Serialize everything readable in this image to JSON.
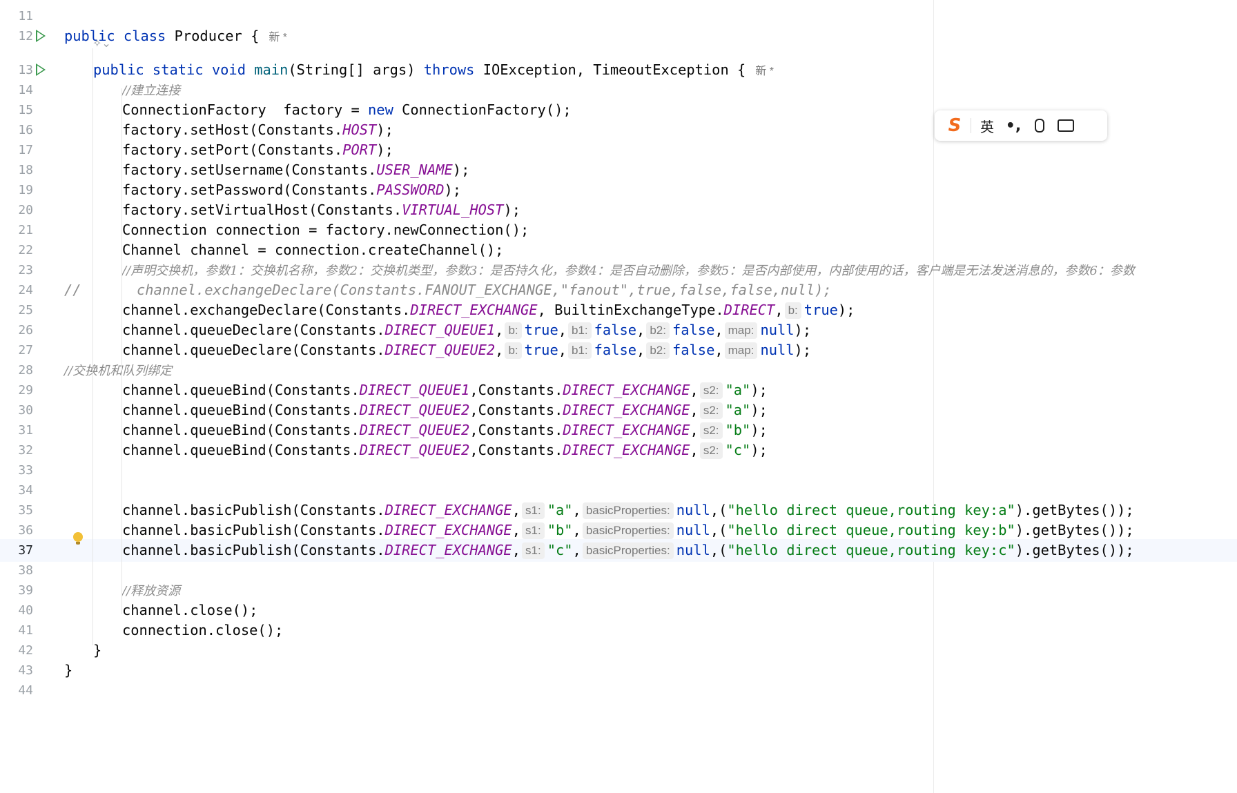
{
  "editor": {
    "new_mark": "新 *",
    "lines": [
      {
        "n": "11"
      },
      {
        "n": "12"
      },
      {
        "n": "13"
      },
      {
        "n": "14"
      },
      {
        "n": "15"
      },
      {
        "n": "16"
      },
      {
        "n": "17"
      },
      {
        "n": "18"
      },
      {
        "n": "19"
      },
      {
        "n": "20"
      },
      {
        "n": "21"
      },
      {
        "n": "22"
      },
      {
        "n": "23"
      },
      {
        "n": "24"
      },
      {
        "n": "25"
      },
      {
        "n": "26"
      },
      {
        "n": "27"
      },
      {
        "n": "28"
      },
      {
        "n": "29"
      },
      {
        "n": "30"
      },
      {
        "n": "31"
      },
      {
        "n": "32"
      },
      {
        "n": "33"
      },
      {
        "n": "34"
      },
      {
        "n": "35"
      },
      {
        "n": "36"
      },
      {
        "n": "37"
      },
      {
        "n": "38"
      },
      {
        "n": "39"
      },
      {
        "n": "40"
      },
      {
        "n": "41"
      },
      {
        "n": "42"
      },
      {
        "n": "43"
      },
      {
        "n": "44"
      }
    ],
    "current_line": "37",
    "code": {
      "l12_a": "public class ",
      "l12_b": "Producer {",
      "l13_a": "public static void ",
      "l13_b": "main",
      "l13_c": "(String[] args) ",
      "l13_d": "throws ",
      "l13_e": "IOException, TimeoutException {",
      "l14": "//建立连接",
      "l15_a": "ConnectionFactory  factory = ",
      "l15_b": "new ",
      "l15_c": "ConnectionFactory();",
      "l16_a": "factory.setHost(Constants.",
      "l16_b": "HOST",
      "l16_c": ");",
      "l17_a": "factory.setPort(Constants.",
      "l17_b": "PORT",
      "l17_c": ");",
      "l18_a": "factory.setUsername(Constants.",
      "l18_b": "USER_NAME",
      "l18_c": ");",
      "l19_a": "factory.setPassword(Constants.",
      "l19_b": "PASSWORD",
      "l19_c": ");",
      "l20_a": "factory.setVirtualHost(Constants.",
      "l20_b": "VIRTUAL_HOST",
      "l20_c": ");",
      "l21": "Connection connection = factory.newConnection();",
      "l22": "Channel channel = connection.createChannel();",
      "l23": "//声明交换机，参数1：交换机名称，参数2：交换机类型，参数3：是否持久化，参数4：是否自动删除，参数5：是否内部使用，内部使用的话，客户端是无法发送消息的，参数6：参数",
      "l24_a": "//",
      "l24_b": "channel.exchangeDeclare(Constants.FANOUT_EXCHANGE,\"fanout\",true,false,false,null);",
      "l25_a": "channel.exchangeDeclare(Constants.",
      "l25_b": "DIRECT_EXCHANGE",
      "l25_c": ", BuiltinExchangeType.",
      "l25_d": "DIRECT",
      "l25_e": ",",
      "l25_h": "b:",
      "l25_f": "true",
      "l25_g": ");",
      "qd_a": "channel.queueDeclare(Constants.",
      "l26_q": "DIRECT_QUEUE1",
      "l27_q": "DIRECT_QUEUE2",
      "hint_b": "b:",
      "hint_b1": "b1:",
      "hint_b2": "b2:",
      "hint_map": "map:",
      "true": "true",
      "false": "false",
      "null": "null",
      "comma": ",",
      "close": ");",
      "l28": "//交换机和队列绑定",
      "qb_a": "channel.queueBind(Constants.",
      "qb_mid": ",Constants.",
      "qb_ex": "DIRECT_EXCHANGE",
      "hint_s2": "s2:",
      "s_a": "\"a\"",
      "s_b": "\"b\"",
      "s_c": "\"c\"",
      "q1": "DIRECT_QUEUE1",
      "q2": "DIRECT_QUEUE2",
      "bp_a": "channel.basicPublish(Constants.",
      "hint_s1": "s1:",
      "hint_bp": "basicProperties:",
      "bp_mid": ",(",
      "msg_a": "\"hello direct queue,routing key:a\"",
      "msg_b": "\"hello direct queue,routing key:b\"",
      "msg_c": "\"hello direct queue,routing key:c\"",
      "bp_end": ").getBytes());",
      "l39": "//释放资源",
      "l40": "channel.close();",
      "l41": "connection.close();",
      "l42": "}",
      "l43": "}"
    }
  },
  "ime": {
    "logo": "S",
    "lang": "英",
    "punct": "•,",
    "icons": [
      "sogou-logo-icon",
      "mic-icon",
      "keyboard-icon"
    ]
  }
}
